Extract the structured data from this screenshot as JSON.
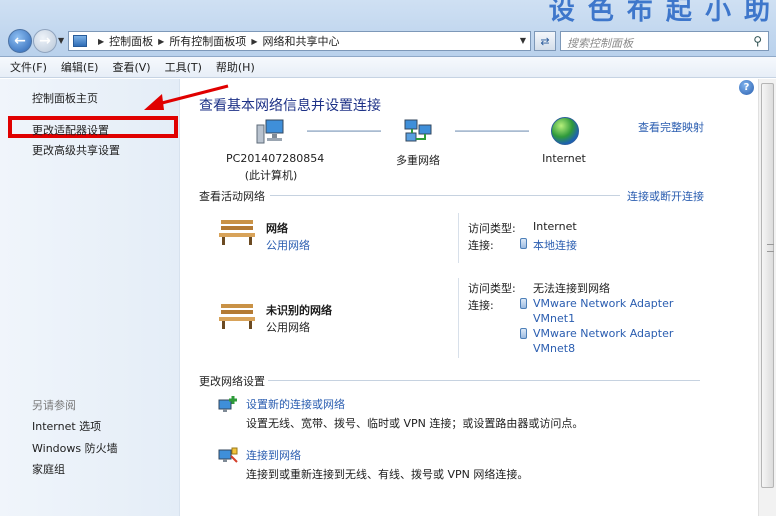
{
  "watermark": "设 色 布 起 小 助",
  "address": {
    "crumbs": [
      "控制面板",
      "所有控制面板项",
      "网络和共享中心"
    ],
    "search_placeholder": "搜索控制面板"
  },
  "menu": [
    "文件(F)",
    "编辑(E)",
    "查看(V)",
    "工具(T)",
    "帮助(H)"
  ],
  "sidebar": {
    "home": "控制面板主页",
    "adapter": "更改适配器设置",
    "advanced": "更改高级共享设置",
    "see_also": "另请参阅",
    "links": [
      "Internet 选项",
      "Windows 防火墙",
      "家庭组"
    ]
  },
  "main": {
    "title": "查看基本网络信息并设置连接",
    "full_map": "查看完整映射",
    "map": {
      "pc_name": "PC201407280854",
      "pc_sub": "(此计算机)",
      "middle": "多重网络",
      "internet": "Internet"
    },
    "active_title": "查看活动网络",
    "connect_disconnect": "连接或断开连接",
    "networks": [
      {
        "name": "网络",
        "type": "公用网络",
        "access_label": "访问类型:",
        "access_value": "Internet",
        "conn_label": "连接:",
        "connections": [
          "本地连接"
        ]
      },
      {
        "name": "未识别的网络",
        "type": "公用网络",
        "access_label": "访问类型:",
        "access_value": "无法连接到网络",
        "conn_label": "连接:",
        "connections": [
          "VMware Network Adapter",
          "VMnet1",
          "VMware Network Adapter",
          "VMnet8"
        ]
      }
    ],
    "change_title": "更改网络设置",
    "tasks": [
      {
        "link": "设置新的连接或网络",
        "desc": "设置无线、宽带、拨号、临时或 VPN 连接；或设置路由器或访问点。"
      },
      {
        "link": "连接到网络",
        "desc": "连接到或重新连接到无线、有线、拨号或 VPN 网络连接。"
      }
    ]
  }
}
